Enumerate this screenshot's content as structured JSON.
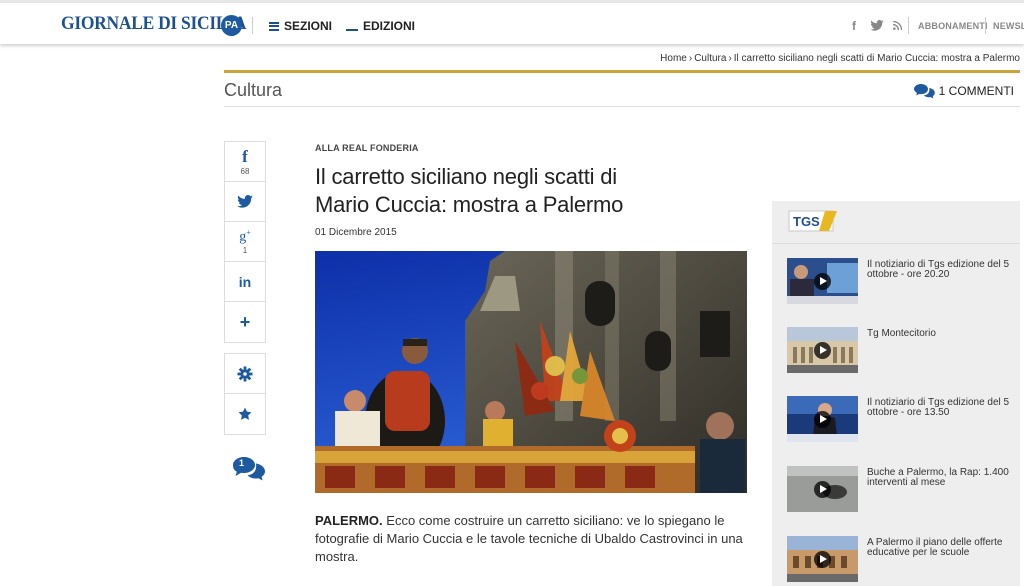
{
  "header": {
    "logo_text": "GIORNALE DI SICILIA",
    "city_badge": "PA",
    "nav": [
      {
        "label": "SEZIONI",
        "icon": "hamburger-icon"
      },
      {
        "label": "EDIZIONI",
        "icon": "underline-icon"
      }
    ],
    "social_icons": [
      "facebook-icon",
      "twitter-icon",
      "rss-icon"
    ],
    "links": [
      "ABBONAMENTI",
      "NEWSL"
    ]
  },
  "breadcrumb": {
    "items": [
      "Home",
      "Cultura",
      "Il carretto siciliano negli scatti di Mario Cuccia: mostra a Palermo"
    ],
    "separator": "›"
  },
  "section": {
    "title": "Cultura",
    "comments_label": "1 COMMENTI",
    "accent_color": "#c8a43a"
  },
  "share": {
    "facebook_count": "68",
    "gplus_count": "1",
    "comment_count": "1"
  },
  "article": {
    "kicker": "ALLA REAL FONDERIA",
    "headline_line1": "Il carretto siciliano negli scatti di",
    "headline_line2": "Mario Cuccia: mostra a Palermo",
    "date": "01 Dicembre 2015",
    "lead_strong": "PALERMO.",
    "lead_text": " Ecco come costruire un carretto siciliano: ve lo spiegano le fotografie di Mario Cuccia e le tavole tecniche di Ubaldo Castrovinci in una mostra."
  },
  "sidebar": {
    "brand": "TGS",
    "videos": [
      {
        "title": "Il notiziario di Tgs edizione del 5 ottobre - ore 20.20"
      },
      {
        "title": "Tg Montecitorio"
      },
      {
        "title": "Il notiziario di Tgs edizione del 5 ottobre - ore 13.50"
      },
      {
        "title": "Buche a Palermo, la Rap: 1.400 interventi al mese"
      },
      {
        "title": "A Palermo il piano delle offerte educative per le scuole"
      }
    ]
  },
  "colors": {
    "brand_blue": "#1e4f8f",
    "sidebar_bg": "#eeeeee"
  }
}
